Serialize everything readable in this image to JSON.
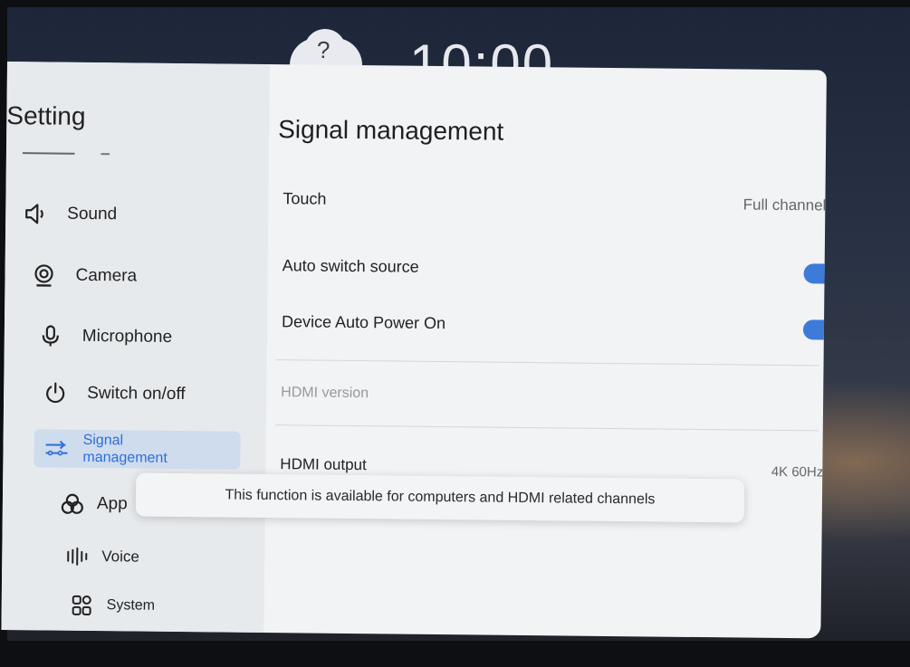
{
  "clock": {
    "time": "10:00",
    "weather_symbol": "?"
  },
  "sidebar": {
    "title": "Setting",
    "items": [
      {
        "label": "Sound",
        "icon": "speaker-icon"
      },
      {
        "label": "Camera",
        "icon": "camera-icon"
      },
      {
        "label": "Microphone",
        "icon": "microphone-icon"
      },
      {
        "label": "Switch on/off",
        "icon": "power-icon"
      },
      {
        "label": "Signal\nmanagement",
        "icon": "signal-icon",
        "selected": true
      },
      {
        "label": "App",
        "icon": "app-icon"
      },
      {
        "label": "Voice",
        "icon": "voice-icon"
      },
      {
        "label": "System",
        "icon": "system-icon"
      }
    ]
  },
  "main": {
    "title": "Signal management",
    "rows": [
      {
        "label": "Touch",
        "value": "Full channel",
        "type": "link"
      },
      {
        "label": "Auto switch source",
        "type": "toggle",
        "on": true
      },
      {
        "label": "Device Auto Power On",
        "type": "toggle",
        "on": true
      },
      {
        "label": "HDMI version",
        "type": "link",
        "disabled": true
      },
      {
        "label": "HDMI output",
        "value": "4K 60Hz",
        "type": "link"
      }
    ]
  },
  "toast": {
    "message": "This function is available for computers and HDMI related channels"
  },
  "colors": {
    "accent": "#3d7bd9",
    "selected_bg": "#cfdcee",
    "panel_bg": "#f1f3f5",
    "sidebar_bg": "#e7eaed"
  }
}
